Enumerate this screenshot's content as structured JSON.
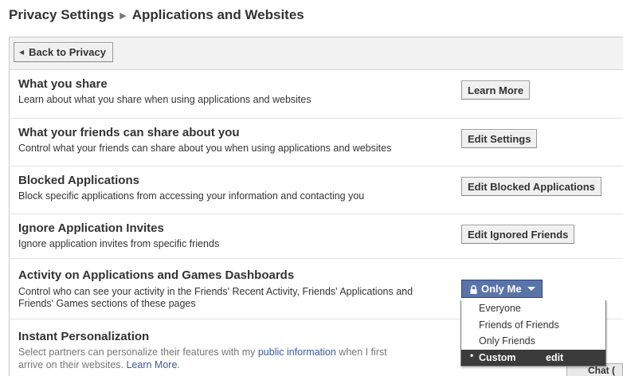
{
  "breadcrumb": {
    "parent": "Privacy Settings",
    "current": "Applications and Websites"
  },
  "toolbar": {
    "back_label": "Back to Privacy"
  },
  "sections": [
    {
      "title": "What you share",
      "desc": "Learn about what you share when using applications and websites",
      "button": "Learn More"
    },
    {
      "title": "What your friends can share about you",
      "desc": "Control what your friends can share about you when using applications and websites",
      "button": "Edit Settings"
    },
    {
      "title": "Blocked Applications",
      "desc": "Block specific applications from accessing your information and contacting you",
      "button": "Edit Blocked Applications"
    },
    {
      "title": "Ignore Application Invites",
      "desc": "Ignore application invites from specific friends",
      "button": "Edit Ignored Friends"
    },
    {
      "title": "Activity on Applications and Games Dashboards",
      "desc_line1": "Control who can see your activity in the Friends' Recent Activity, Friends' Applications and",
      "desc_line2": "Friends' Games sections of these pages",
      "privacy_value": "Only Me"
    },
    {
      "title": "Instant Personalization",
      "desc_line1_pre": "Select partners can personalize their features with my ",
      "desc_link": "public information",
      "desc_line1_post": " when I first",
      "desc_line2_pre": "arrive on their websites. ",
      "desc_link2": "Learn More",
      "desc_line2_post": "."
    }
  ],
  "privacy_menu": {
    "options": [
      "Everyone",
      "Friends of Friends",
      "Only Friends"
    ],
    "selected": "Custom",
    "selected_marker": "•",
    "edit_label": "edit"
  },
  "chat": {
    "label": "Chat ("
  },
  "colors": {
    "link": "#3b5998",
    "privacy_button": "#5b74a8",
    "menu_selected": "#3b3b3b"
  }
}
